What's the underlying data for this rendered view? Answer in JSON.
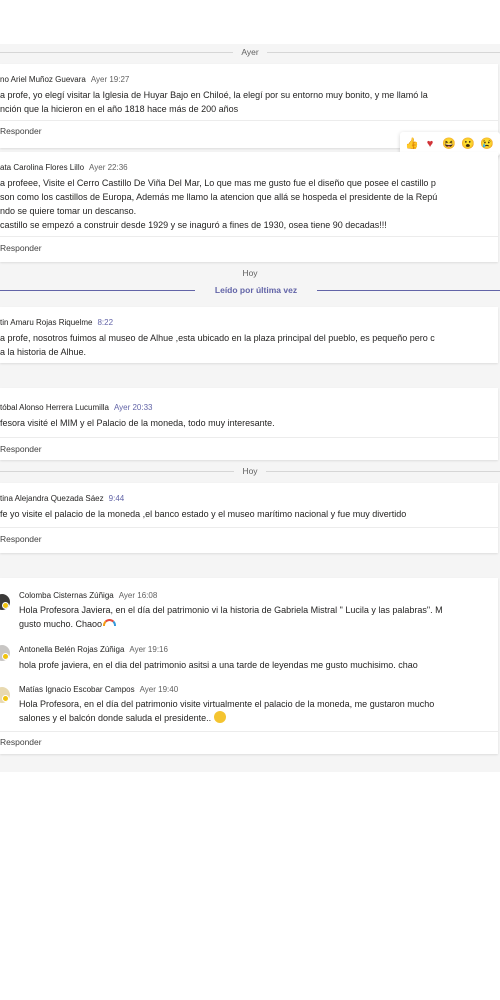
{
  "dividers": {
    "yesterday": "Ayer",
    "today_1": "Hoy",
    "today_2": "Hoy",
    "read_last": "Leído por última vez"
  },
  "reply_label": "Responder",
  "reactions": [
    "thumbs-up-icon",
    "heart-icon",
    "laughing-icon",
    "surprised-icon",
    "sad-icon"
  ],
  "messages": [
    {
      "author": "no Ariel Muñoz Guevara",
      "time": "Ayer 19:27",
      "lines": [
        "a profe, yo elegí visitar la Iglesia de Huyar Bajo en Chiloé, la elegí por su entorno muy bonito, y me llamó la",
        "nción que la hicieron en el año 1818 hace más de 200 años"
      ]
    },
    {
      "author": "ata Carolina Flores Lillo",
      "time": "Ayer 22:36",
      "lines": [
        "a profeee, Visite el Cerro Castillo De Viña Del Mar, Lo que mas me gusto fue el diseño que posee el castillo p",
        " son como los castillos de Europa, Además me llamo la atencion que allá se hospeda el presidente de la Repú",
        "ndo se quiere tomar un descanso.",
        "castillo se empezó a construir desde 1929 y se inaguró a fines de 1930, osea tiene 90 decadas!!!"
      ]
    },
    {
      "author": "tin Amaru Rojas Riquelme",
      "time": "8:22",
      "lines": [
        "a profe, nosotros fuimos al museo de Alhue ,esta ubicado en la plaza principal del pueblo, es pequeño pero c",
        "a la historia de Alhue."
      ]
    },
    {
      "author": "tóbal Alonso Herrera Lucumilla",
      "time": "Ayer 20:33",
      "lines": [
        "fesora visité el MIM y el Palacio de la moneda, todo muy interesante."
      ]
    },
    {
      "author": "tina Alejandra Quezada Sáez",
      "time": "9:44",
      "lines": [
        "fe yo visite el palacio de la moneda ,el banco estado y el museo marítimo nacional y fue muy divertido"
      ]
    }
  ],
  "thread": [
    {
      "author": "Colomba Cisternas Zúñiga",
      "time": "Ayer 16:08",
      "lines": [
        "Hola Profesora Javiera, en el día del patrimonio vi la historia de Gabriela Mistral \" Lucila y las palabras\". M",
        "gusto mucho. Chaoo"
      ]
    },
    {
      "author": "Antonella Belén Rojas Zúñiga",
      "time": "Ayer 19:16",
      "lines": [
        "hola profe javiera, en el dia del patrimonio asitsi a una tarde de leyendas me gusto muchisimo. chao"
      ]
    },
    {
      "author": "Matías Ignacio Escobar Campos",
      "time": "Ayer 19:40",
      "lines": [
        "Hola Profesora, en el día del patrimonio visite virtualmente el palacio de la moneda, me gustaron mucho",
        "salones y el balcón donde saluda el presidente.."
      ]
    }
  ]
}
